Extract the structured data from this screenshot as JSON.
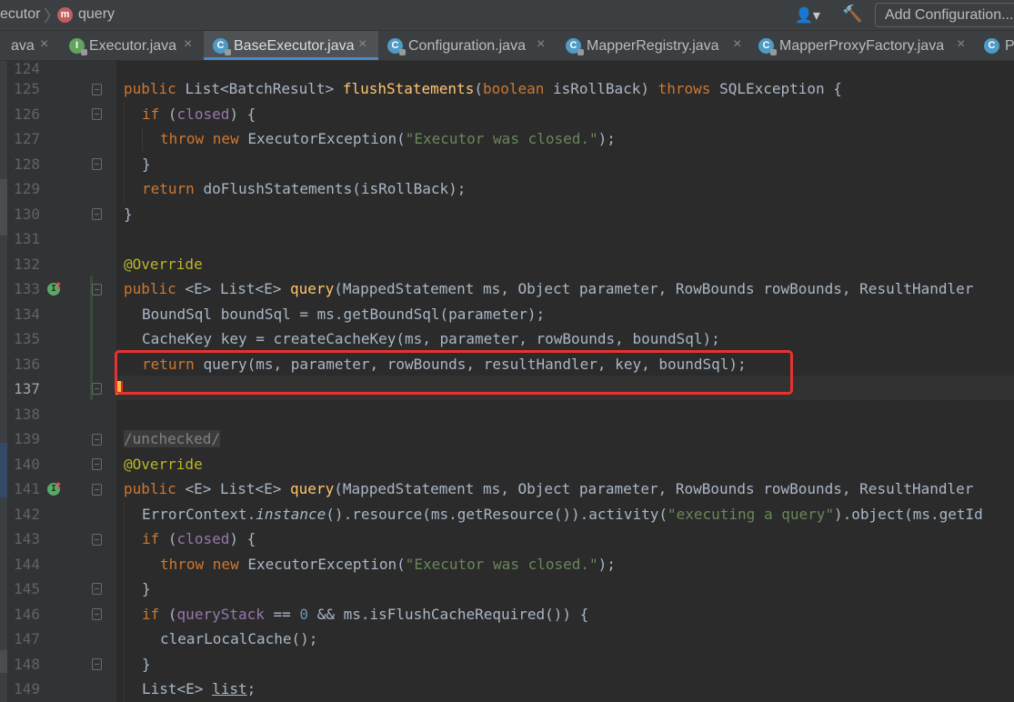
{
  "navbar": {
    "breadcrumb_class": "ecutor",
    "breadcrumb_method_icon": "m",
    "breadcrumb_method": "query",
    "add_configuration_label": "Add Configuration..."
  },
  "tabs": [
    {
      "label": "ava",
      "icon": "",
      "close": "×"
    },
    {
      "label": "Executor.java",
      "icon": "I",
      "close": "×"
    },
    {
      "label": "BaseExecutor.java",
      "icon": "C",
      "close": "×"
    },
    {
      "label": "Configuration.java",
      "icon": "C",
      "close": "×"
    },
    {
      "label": "MapperRegistry.java",
      "icon": "C",
      "close": "×"
    },
    {
      "label": "MapperProxyFactory.java",
      "icon": "C",
      "close": "×"
    },
    {
      "label": "Pl",
      "icon": "C",
      "close": ""
    }
  ],
  "line_numbers": [
    "124",
    "125",
    "126",
    "127",
    "128",
    "129",
    "130",
    "131",
    "132",
    "133",
    "134",
    "135",
    "136",
    "137",
    "138",
    "139",
    "140",
    "141",
    "142",
    "143",
    "144",
    "145",
    "146",
    "147",
    "148",
    "149"
  ],
  "code": {
    "l125": {
      "a": "public ",
      "b": "List<BatchResult> ",
      "c": "flushStatements",
      "d": "(",
      "e": "boolean ",
      "f": "isRollBack) ",
      "g": "throws ",
      "h": "SQLException {"
    },
    "l126": {
      "a": "if ",
      "b": "(",
      "c": "closed",
      "d": ") {"
    },
    "l127": {
      "a": "throw new ",
      "b": "ExecutorException(",
      "c": "\"Executor was closed.\"",
      "d": ");"
    },
    "l128": {
      "a": "}"
    },
    "l129": {
      "a": "return ",
      "b": "doFlushStatements(isRollBack);"
    },
    "l130": {
      "a": "}"
    },
    "l132": {
      "a": "@Override"
    },
    "l133": {
      "a": "public ",
      "b": "<E> List<E> ",
      "c": "query",
      "d": "(MappedStatement ms, Object parameter, RowBounds rowBounds, ResultHandler"
    },
    "l134": {
      "a": "BoundSql boundSql = ms.getBoundSql(parameter);"
    },
    "l135": {
      "a": "CacheKey key = createCacheKey(ms, parameter, rowBounds, boundSql);"
    },
    "l136": {
      "a": "return ",
      "b": "query(ms, parameter, rowBounds, resultHandler, key, boundSql);"
    },
    "l139": {
      "a": "/unchecked/"
    },
    "l140": {
      "a": "@Override"
    },
    "l141": {
      "a": "public ",
      "b": "<E> List<E> ",
      "c": "query",
      "d": "(MappedStatement ms, Object parameter, RowBounds rowBounds, ResultHandler"
    },
    "l142": {
      "a": "ErrorContext.",
      "b": "instance",
      "c": "().resource(ms.getResource()).activity(",
      "d": "\"executing a query\"",
      "e": ").object(ms.getId"
    },
    "l143": {
      "a": "if ",
      "b": "(",
      "c": "closed",
      "d": ") {"
    },
    "l144": {
      "a": "throw new ",
      "b": "ExecutorException(",
      "c": "\"Executor was closed.\"",
      "d": ");"
    },
    "l145": {
      "a": "}"
    },
    "l146": {
      "a": "if ",
      "b": "(",
      "c": "queryStack ",
      "d": "== ",
      "e": "0 ",
      "f": "&& ms.isFlushCacheRequired()) {"
    },
    "l147": {
      "a": "clearLocalCache();"
    },
    "l148": {
      "a": "}"
    },
    "l149": {
      "a": "List<E> ",
      "b": "list",
      "c": ";"
    }
  },
  "colors": {
    "keyword": "#cc7832",
    "method": "#ffc66d",
    "string": "#6a8759",
    "field": "#9876aa",
    "annotation": "#bbb529",
    "number": "#6897bb",
    "highlight_box": "#e8322d"
  }
}
